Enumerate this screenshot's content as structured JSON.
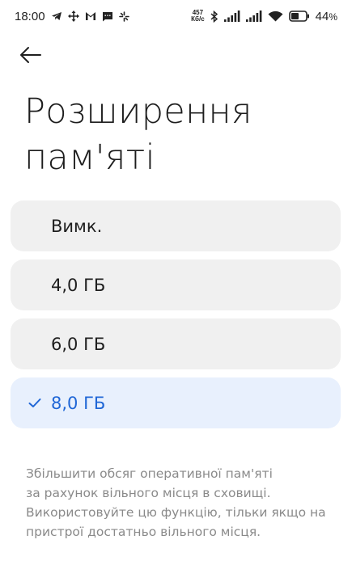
{
  "status_bar": {
    "time": "18:00",
    "net_speed_value": "457",
    "net_speed_unit": "Кб/с",
    "battery_percent": "44",
    "battery_suffix": "%"
  },
  "header": {
    "title_line1": "Розширення",
    "title_line2": "пам'яті"
  },
  "options": [
    {
      "label": "Вимк.",
      "selected": false
    },
    {
      "label": "4,0 ГБ",
      "selected": false
    },
    {
      "label": "6,0 ГБ",
      "selected": false
    },
    {
      "label": "8,0 ГБ",
      "selected": true
    }
  ],
  "description": {
    "line1": "Збільшити обсяг оперативної пам'яті",
    "line2": "за рахунок вільного місця в сховищі.",
    "line3": "Використовуйте цю функцію, тільки якщо на",
    "line4": "пристрої достатньо вільного місця."
  },
  "colors": {
    "accent": "#1f66d6",
    "option_bg": "#f0f0f0",
    "selected_bg": "#e8f0fd"
  },
  "icons": {
    "back": "arrow-left-icon",
    "check": "check-icon"
  }
}
